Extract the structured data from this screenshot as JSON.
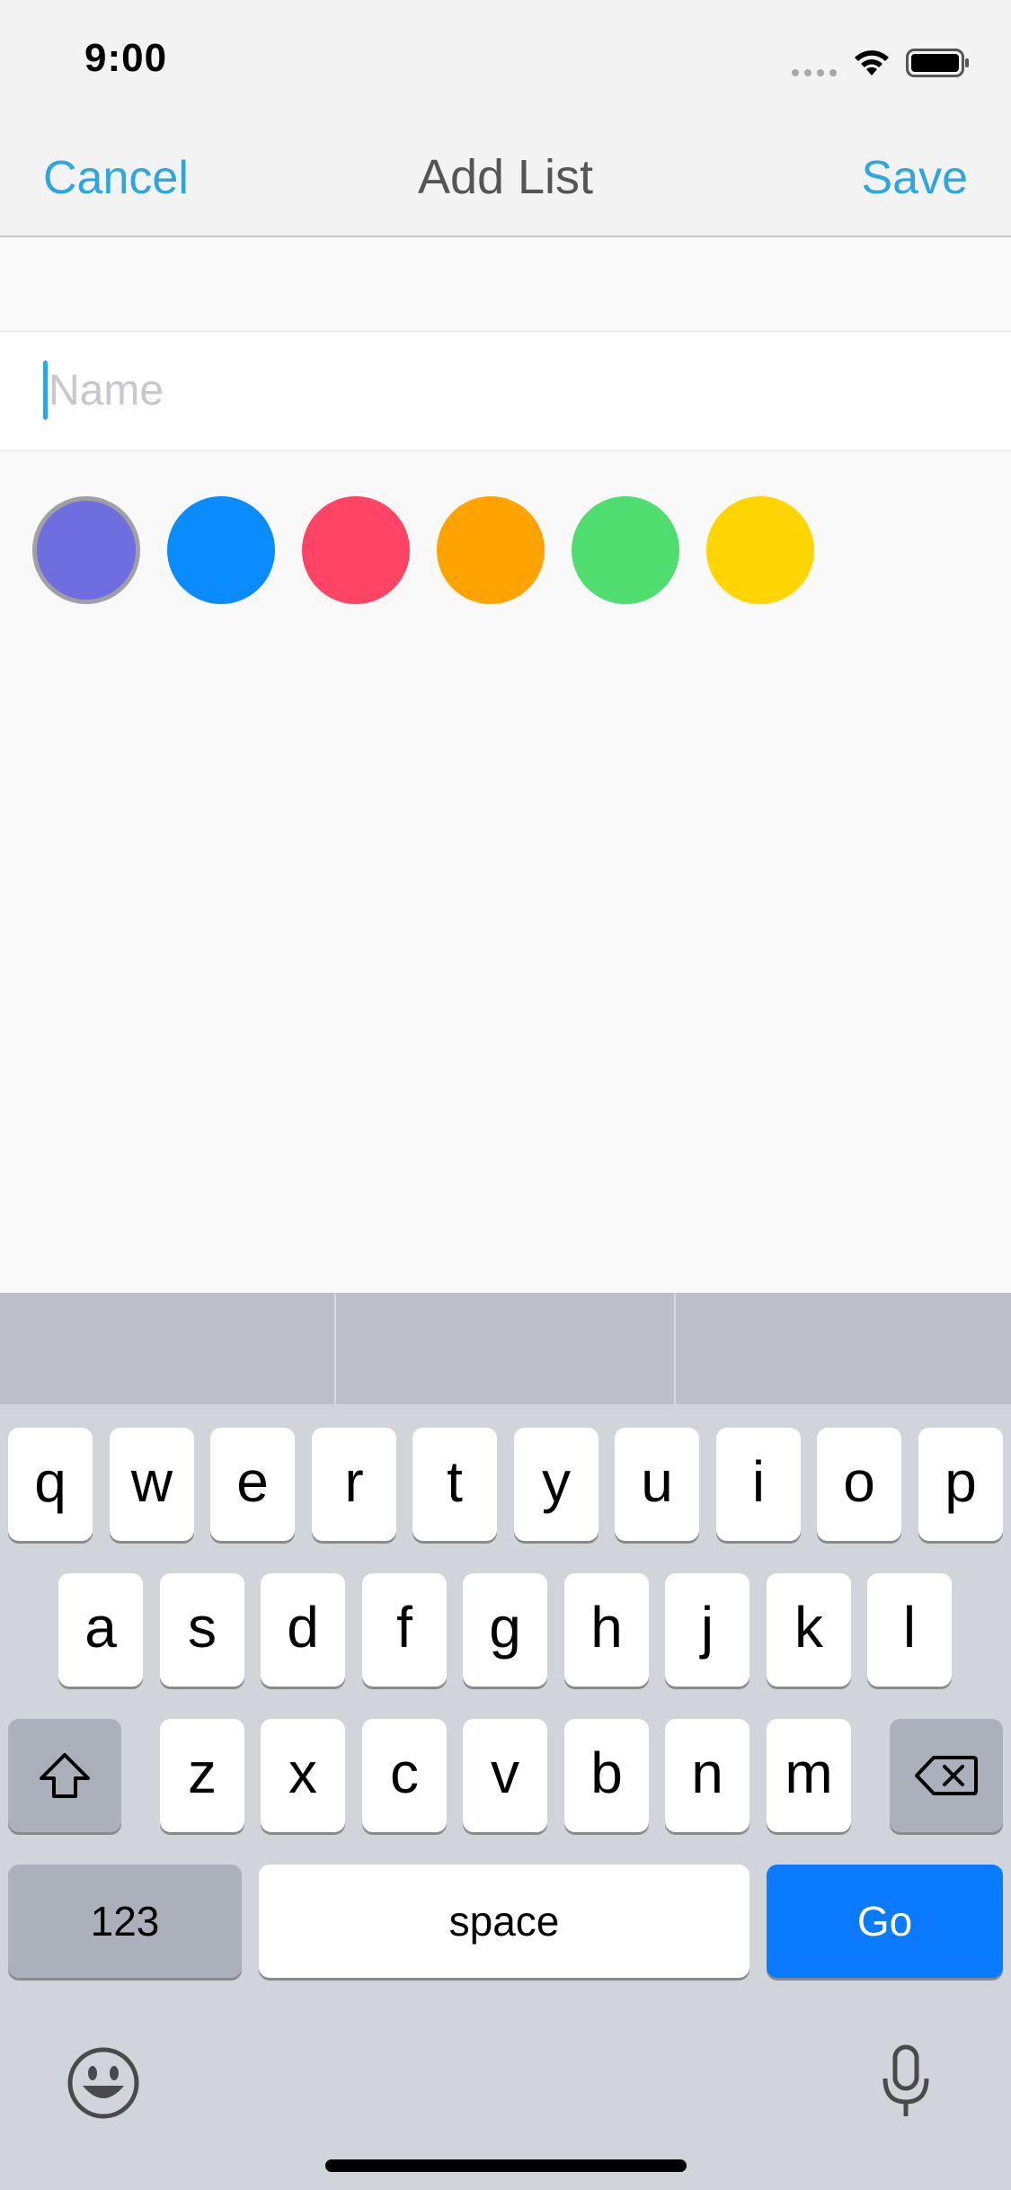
{
  "status_bar": {
    "time": "9:00"
  },
  "nav": {
    "cancel_label": "Cancel",
    "title": "Add List",
    "save_label": "Save"
  },
  "name_field": {
    "placeholder": "Name",
    "value": ""
  },
  "colors": {
    "accent": "#2ea7de",
    "swatches": [
      {
        "name": "purple",
        "hex": "#6e6ee0",
        "selected": true
      },
      {
        "name": "blue",
        "hex": "#0a8cff",
        "selected": false
      },
      {
        "name": "pink",
        "hex": "#ff4466",
        "selected": false
      },
      {
        "name": "orange",
        "hex": "#ffa300",
        "selected": false
      },
      {
        "name": "green",
        "hex": "#4fdd70",
        "selected": false
      },
      {
        "name": "yellow",
        "hex": "#ffd500",
        "selected": false
      }
    ]
  },
  "keyboard": {
    "row1": [
      "q",
      "w",
      "e",
      "r",
      "t",
      "y",
      "u",
      "i",
      "o",
      "p"
    ],
    "row2": [
      "a",
      "s",
      "d",
      "f",
      "g",
      "h",
      "j",
      "k",
      "l"
    ],
    "row3": [
      "z",
      "x",
      "c",
      "v",
      "b",
      "n",
      "m"
    ],
    "numbers_label": "123",
    "space_label": "space",
    "go_label": "Go",
    "icons": {
      "shift": "shift-icon",
      "delete": "delete-icon",
      "emoji": "emoji-icon",
      "mic": "microphone-icon"
    }
  }
}
